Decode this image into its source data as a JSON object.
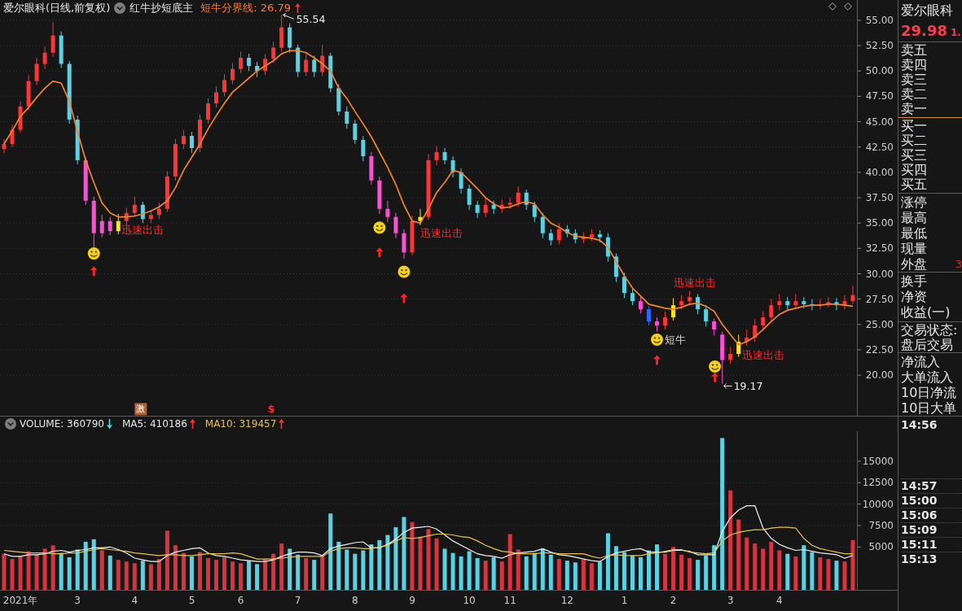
{
  "price_pane": {
    "header": {
      "title": "爱尔眼科(日线,前复权)",
      "indicator": "红牛抄短底主",
      "value": {
        "label": "短牛分界线: 26.79",
        "rising": true
      }
    },
    "chart_data": [
      {
        "type": "candlestick",
        "ylim": [
          16,
          57
        ],
        "tick_labels": "y",
        "grid": true,
        "yticks": [
          {
            "value": 20,
            "label": "20.00"
          },
          {
            "value": 22.5,
            "label": "22.50"
          },
          {
            "value": 25,
            "label": "25.00"
          },
          {
            "value": 27.5,
            "label": "27.50"
          },
          {
            "value": 30,
            "label": "30.00"
          },
          {
            "value": 32.5,
            "label": "32.50"
          },
          {
            "value": 35,
            "label": "35.00"
          },
          {
            "value": 37.5,
            "label": "37.50"
          },
          {
            "value": 40,
            "label": "40.00"
          },
          {
            "value": 42.5,
            "label": "42.50"
          },
          {
            "value": 45,
            "label": "45.00"
          },
          {
            "value": 47.5,
            "label": "47.50"
          },
          {
            "value": 50,
            "label": "50.00"
          },
          {
            "value": 52.5,
            "label": "52.50"
          },
          {
            "value": 55,
            "label": "55.00"
          }
        ],
        "series": [
          {
            "type": "candlestick",
            "ohlc": [
              [
                42.3,
                43.3,
                41.9,
                42.8
              ],
              [
                42.8,
                44.7,
                42.5,
                44.2
              ],
              [
                44.2,
                47.0,
                43.9,
                46.5
              ],
              [
                46.5,
                49.6,
                46.1,
                49.0
              ],
              [
                49.0,
                51.3,
                48.6,
                50.7
              ],
              [
                50.7,
                52.4,
                50.2,
                51.8
              ],
              [
                51.8,
                54.8,
                51.4,
                53.5
              ],
              [
                53.5,
                53.9,
                50.3,
                50.7
              ],
              [
                50.7,
                51.0,
                44.8,
                45.2
              ],
              [
                45.2,
                45.6,
                40.8,
                41.2
              ],
              [
                41.2,
                41.5,
                36.8,
                37.2
              ],
              [
                37.2,
                37.6,
                32.6,
                34.0
              ],
              [
                34.0,
                35.8,
                33.6,
                35.2
              ],
              [
                35.2,
                35.6,
                33.8,
                34.2
              ],
              [
                34.2,
                35.9,
                33.9,
                35.2
              ],
              [
                35.2,
                36.5,
                34.8,
                36.0
              ],
              [
                36.0,
                37.6,
                35.6,
                36.8
              ],
              [
                36.8,
                37.1,
                35.0,
                35.4
              ],
              [
                35.4,
                36.3,
                35.0,
                35.8
              ],
              [
                35.8,
                37.0,
                35.4,
                36.4
              ],
              [
                36.4,
                40.1,
                36.1,
                39.6
              ],
              [
                39.6,
                43.3,
                39.2,
                42.8
              ],
              [
                42.8,
                44.2,
                42.3,
                43.6
              ],
              [
                43.6,
                44.0,
                41.9,
                42.4
              ],
              [
                42.4,
                45.7,
                42.0,
                45.2
              ],
              [
                45.2,
                47.3,
                44.8,
                46.8
              ],
              [
                46.8,
                48.5,
                46.4,
                47.9
              ],
              [
                47.9,
                49.7,
                47.5,
                49.1
              ],
              [
                49.1,
                50.8,
                48.7,
                50.2
              ],
              [
                50.2,
                51.9,
                49.8,
                51.3
              ],
              [
                51.3,
                51.7,
                50.0,
                50.5
              ],
              [
                50.5,
                50.9,
                49.4,
                50.0
              ],
              [
                50.0,
                51.7,
                49.6,
                51.2
              ],
              [
                51.2,
                52.9,
                50.8,
                52.3
              ],
              [
                52.3,
                55.54,
                51.9,
                54.3
              ],
              [
                54.3,
                54.7,
                51.8,
                52.3
              ],
              [
                52.3,
                52.6,
                49.4,
                49.9
              ],
              [
                49.9,
                51.7,
                49.5,
                51.1
              ],
              [
                51.1,
                51.5,
                49.4,
                49.9
              ],
              [
                49.9,
                52.6,
                49.5,
                51.5
              ],
              [
                51.5,
                51.8,
                47.9,
                48.3
              ],
              [
                48.3,
                48.7,
                45.6,
                46.0
              ],
              [
                46.0,
                46.5,
                44.3,
                44.8
              ],
              [
                44.8,
                45.2,
                42.8,
                43.2
              ],
              [
                43.2,
                43.6,
                41.1,
                41.6
              ],
              [
                41.6,
                42.0,
                38.8,
                39.2
              ],
              [
                39.2,
                39.6,
                35.9,
                36.4
              ],
              [
                36.4,
                37.2,
                35.1,
                35.6
              ],
              [
                35.6,
                36.0,
                33.5,
                34.0
              ],
              [
                34.0,
                34.4,
                31.5,
                32.1
              ],
              [
                32.1,
                35.7,
                31.8,
                35.2
              ],
              [
                35.2,
                36.4,
                34.8,
                35.6
              ],
              [
                35.6,
                41.8,
                35.3,
                41.2
              ],
              [
                41.2,
                42.6,
                40.7,
                42.0
              ],
              [
                42.0,
                42.4,
                40.8,
                41.2
              ],
              [
                41.2,
                41.6,
                39.5,
                40.0
              ],
              [
                40.0,
                40.4,
                37.9,
                38.4
              ],
              [
                38.4,
                38.8,
                36.3,
                36.8
              ],
              [
                36.8,
                37.2,
                35.5,
                36.0
              ],
              [
                36.0,
                37.4,
                35.6,
                36.8
              ],
              [
                36.8,
                37.2,
                35.9,
                36.4
              ],
              [
                36.4,
                37.3,
                36.0,
                36.8
              ],
              [
                36.8,
                37.5,
                36.4,
                37.0
              ],
              [
                37.0,
                38.6,
                36.6,
                38.0
              ],
              [
                38.0,
                38.3,
                36.3,
                36.8
              ],
              [
                36.8,
                37.1,
                35.1,
                35.6
              ],
              [
                35.6,
                36.0,
                33.5,
                34.0
              ],
              [
                34.0,
                34.4,
                32.8,
                33.3
              ],
              [
                33.3,
                35.0,
                32.9,
                34.4
              ],
              [
                34.4,
                34.8,
                33.6,
                34.0
              ],
              [
                34.0,
                34.4,
                33.0,
                33.4
              ],
              [
                33.4,
                34.1,
                33.0,
                33.6
              ],
              [
                33.6,
                34.4,
                33.2,
                33.9
              ],
              [
                33.9,
                34.3,
                33.1,
                33.6
              ],
              [
                33.6,
                34.0,
                31.2,
                31.7
              ],
              [
                31.7,
                32.0,
                29.2,
                29.7
              ],
              [
                29.7,
                30.1,
                27.6,
                28.1
              ],
              [
                28.1,
                28.5,
                26.9,
                27.3
              ],
              [
                27.3,
                27.7,
                26.1,
                26.5
              ],
              [
                26.5,
                26.8,
                24.9,
                25.3
              ],
              [
                25.3,
                25.7,
                24.3,
                24.9
              ],
              [
                24.9,
                26.3,
                24.5,
                25.7
              ],
              [
                25.7,
                27.6,
                25.4,
                26.9
              ],
              [
                26.9,
                27.9,
                26.5,
                27.3
              ],
              [
                27.3,
                28.3,
                26.9,
                27.7
              ],
              [
                27.7,
                28.0,
                26.0,
                26.5
              ],
              [
                26.5,
                26.9,
                24.8,
                25.3
              ],
              [
                25.3,
                25.6,
                23.9,
                24.5
              ],
              [
                24.0,
                24.3,
                19.17,
                21.5
              ],
              [
                21.5,
                22.8,
                21.1,
                22.1
              ],
              [
                22.1,
                24.0,
                21.8,
                23.3
              ],
              [
                23.3,
                24.5,
                22.9,
                23.7
              ],
              [
                23.7,
                25.5,
                23.3,
                24.9
              ],
              [
                24.9,
                26.3,
                24.5,
                25.7
              ],
              [
                25.7,
                27.5,
                25.3,
                26.9
              ],
              [
                26.9,
                28.0,
                26.4,
                27.3
              ],
              [
                27.3,
                27.7,
                26.4,
                26.9
              ],
              [
                26.9,
                28.0,
                26.5,
                27.3
              ],
              [
                27.3,
                27.7,
                26.6,
                27.0
              ],
              [
                27.0,
                27.5,
                26.4,
                26.9
              ],
              [
                26.9,
                27.5,
                26.5,
                27.0
              ],
              [
                27.0,
                27.7,
                26.7,
                27.2
              ],
              [
                27.2,
                27.6,
                26.4,
                26.9
              ],
              [
                26.9,
                27.9,
                26.5,
                27.3
              ],
              [
                27.3,
                28.8,
                27.0,
                27.9
              ]
            ],
            "colors": [
              "#ff3434",
              "#ff3434",
              "#ff3434",
              "#ff3434",
              "#ff3434",
              "#ff3434",
              "#ff3434",
              "#5ad2e6",
              "#5ad2e6",
              "#5ad2e6",
              "#ff4fd8",
              "#ff4fd8",
              "#ff4fd8",
              "#ff4fd8",
              "#ffe41a",
              "#ff3434",
              "#ff3434",
              "#5ad2e6",
              "#ff3434",
              "#ff3434",
              "#ff3434",
              "#ff3434",
              "#ff3434",
              "#5ad2e6",
              "#ff3434",
              "#ff3434",
              "#ff3434",
              "#ff3434",
              "#ff3434",
              "#ff3434",
              "#5ad2e6",
              "#5ad2e6",
              "#ff3434",
              "#ff3434",
              "#ff3434",
              "#5ad2e6",
              "#5ad2e6",
              "#ff3434",
              "#5ad2e6",
              "#ff3434",
              "#5ad2e6",
              "#5ad2e6",
              "#5ad2e6",
              "#5ad2e6",
              "#5ad2e6",
              "#ff4fd8",
              "#ff4fd8",
              "#ff4fd8",
              "#ff4fd8",
              "#ff4fd8",
              "#ff3434",
              "#ffe41a",
              "#ff3434",
              "#ff3434",
              "#5ad2e6",
              "#5ad2e6",
              "#5ad2e6",
              "#5ad2e6",
              "#5ad2e6",
              "#ff3434",
              "#5ad2e6",
              "#ff3434",
              "#ff3434",
              "#ff3434",
              "#5ad2e6",
              "#5ad2e6",
              "#5ad2e6",
              "#5ad2e6",
              "#ff3434",
              "#5ad2e6",
              "#5ad2e6",
              "#ff3434",
              "#ff3434",
              "#5ad2e6",
              "#5ad2e6",
              "#5ad2e6",
              "#5ad2e6",
              "#5ad2e6",
              "#ff4fd8",
              "#2a66ff",
              "#ff4fd8",
              "#ff3434",
              "#ffe41a",
              "#ff3434",
              "#ff3434",
              "#5ad2e6",
              "#5ad2e6",
              "#ff4fd8",
              "#ff4fd8",
              "#ff3434",
              "#ffe41a",
              "#ff3434",
              "#ff3434",
              "#ff3434",
              "#ff3434",
              "#ff3434",
              "#5ad2e6",
              "#ff3434",
              "#5ad2e6",
              "#5ad2e6",
              "#ff3434",
              "#ff3434",
              "#5ad2e6",
              "#ff3434",
              "#ff3434"
            ]
          },
          {
            "type": "line",
            "color": "#f5832e",
            "values": [
              42.8,
              44.1,
              45.5,
              46.4,
              47.4,
              48.3,
              49.0,
              48.8,
              47.0,
              44.0,
              41.2,
              39.0,
              37.0,
              36.0,
              35.6,
              35.6,
              35.7,
              35.9,
              36.2,
              36.6,
              37.2,
              38.5,
              40.2,
              41.5,
              42.8,
              44.3,
              45.6,
              46.8,
              47.9,
              48.6,
              49.3,
              50.0,
              50.5,
              51.0,
              51.7,
              52.0,
              52.0,
              51.8,
              51.3,
              50.7,
              50.0,
              48.3,
              47.3,
              46.0,
              44.8,
              43.5,
              42.0,
              40.5,
              38.8,
              36.8,
              35.2,
              35.0,
              36.4,
              38.0,
              39.0,
              40.2,
              40.0,
              39.2,
              38.4,
              37.5,
              36.9,
              36.5,
              36.6,
              36.9,
              37.1,
              36.9,
              35.8,
              35.0,
              34.6,
              34.1,
              33.7,
              33.6,
              33.5,
              33.3,
              32.6,
              31.2,
              29.8,
              28.6,
              27.8,
              27.0,
              26.8,
              26.6,
              26.5,
              26.7,
              27.0,
              27.1,
              26.8,
              26.3,
              25.0,
              24.0,
              23.0,
              23.3,
              23.8,
              24.5,
              25.3,
              26.0,
              26.4,
              26.6,
              26.8,
              26.9,
              26.9,
              27.0,
              27.0,
              26.9,
              26.8
            ]
          }
        ],
        "annotations": [
          "55.54",
          "迅速出击",
          "迅速出击",
          "迅速出击",
          "短牛",
          "迅速出击",
          "19.17",
          "激",
          "$"
        ]
      }
    ]
  },
  "volume_pane": {
    "header": [
      {
        "label": "VOLUME: 360790",
        "rising": false,
        "color": "#e6e6e6"
      },
      {
        "label": "MA5: 410186",
        "rising": true,
        "color": "#e6e6e6"
      },
      {
        "label": "MA10: 319457",
        "rising": true,
        "color": "#e3c25a"
      }
    ],
    "chart_data": [
      {
        "type": "bar",
        "ylim": [
          0,
          18500
        ],
        "yticks": [
          5000,
          7500,
          10000,
          12500,
          15000
        ],
        "grid": true,
        "categories": [
          null,
          null,
          "2021年",
          null,
          null,
          null,
          null,
          null,
          null,
          "3",
          null,
          null,
          null,
          null,
          null,
          null,
          "4",
          null,
          null,
          null,
          null,
          null,
          null,
          "5",
          null,
          null,
          null,
          null,
          null,
          "6",
          null,
          null,
          null,
          null,
          null,
          null,
          "7",
          null,
          null,
          null,
          null,
          null,
          null,
          "8",
          null,
          null,
          null,
          null,
          null,
          null,
          "9",
          null,
          null,
          null,
          null,
          null,
          null,
          "10",
          null,
          null,
          null,
          null,
          "11",
          null,
          null,
          null,
          null,
          null,
          null,
          "12",
          null,
          null,
          null,
          null,
          null,
          null,
          "1",
          null,
          null,
          null,
          null,
          null,
          "2",
          null,
          null,
          null,
          null,
          null,
          null,
          "3",
          null,
          null,
          null,
          null,
          null,
          "4",
          null,
          null,
          null,
          null,
          null,
          null,
          null,
          null,
          null
        ],
        "series": [
          {
            "type": "bar",
            "values": [
              4200,
              3600,
              3900,
              4500,
              4100,
              4800,
              5200,
              4300,
              3800,
              4700,
              5600,
              5900,
              4600,
              4000,
              3500,
              3300,
              3100,
              3400,
              3000,
              3600,
              6900,
              5200,
              4300,
              3900,
              4400,
              3700,
              3500,
              3800,
              3300,
              3100,
              3400,
              3000,
              3600,
              4200,
              5400,
              4800,
              4100,
              3700,
              3500,
              4000,
              8900,
              5600,
              4700,
              4200,
              4600,
              5300,
              5800,
              6400,
              7300,
              8500,
              7900,
              6200,
              7100,
              6000,
              4800,
              4300,
              3900,
              4500,
              3700,
              3400,
              3800,
              3300,
              6500,
              4700,
              3900,
              4300,
              4800,
              4100,
              3600,
              3400,
              3200,
              3500,
              3100,
              3300,
              6600,
              5100,
              4400,
              4000,
              3800,
              4600,
              5300,
              4200,
              5000,
              4100,
              3700,
              3500,
              4000,
              5200,
              17700,
              11600,
              8200,
              6100,
              5400,
              4800,
              5600,
              4600,
              4200,
              3900,
              5200,
              4400,
              3800,
              3600,
              3400,
              3300,
              5800
            ],
            "colors": [
              "#d8343f",
              "#d8343f",
              "#d8343f",
              "#d8343f",
              "#d8343f",
              "#d8343f",
              "#d8343f",
              "#5ad2e6",
              "#5ad2e6",
              "#5ad2e6",
              "#5ad2e6",
              "#5ad2e6",
              "#d8343f",
              "#5ad2e6",
              "#d8343f",
              "#d8343f",
              "#d8343f",
              "#5ad2e6",
              "#d8343f",
              "#d8343f",
              "#d8343f",
              "#d8343f",
              "#d8343f",
              "#5ad2e6",
              "#d8343f",
              "#d8343f",
              "#d8343f",
              "#d8343f",
              "#d8343f",
              "#d8343f",
              "#5ad2e6",
              "#5ad2e6",
              "#d8343f",
              "#d8343f",
              "#d8343f",
              "#5ad2e6",
              "#5ad2e6",
              "#d8343f",
              "#5ad2e6",
              "#d8343f",
              "#5ad2e6",
              "#5ad2e6",
              "#5ad2e6",
              "#5ad2e6",
              "#5ad2e6",
              "#5ad2e6",
              "#5ad2e6",
              "#5ad2e6",
              "#5ad2e6",
              "#5ad2e6",
              "#d8343f",
              "#d8343f",
              "#d8343f",
              "#d8343f",
              "#5ad2e6",
              "#5ad2e6",
              "#5ad2e6",
              "#5ad2e6",
              "#5ad2e6",
              "#d8343f",
              "#5ad2e6",
              "#d8343f",
              "#d8343f",
              "#d8343f",
              "#5ad2e6",
              "#5ad2e6",
              "#5ad2e6",
              "#5ad2e6",
              "#d8343f",
              "#5ad2e6",
              "#5ad2e6",
              "#d8343f",
              "#d8343f",
              "#5ad2e6",
              "#5ad2e6",
              "#5ad2e6",
              "#5ad2e6",
              "#5ad2e6",
              "#5ad2e6",
              "#5ad2e6",
              "#5ad2e6",
              "#d8343f",
              "#d8343f",
              "#d8343f",
              "#d8343f",
              "#5ad2e6",
              "#5ad2e6",
              "#5ad2e6",
              "#5ad2e6",
              "#d8343f",
              "#d8343f",
              "#d8343f",
              "#d8343f",
              "#d8343f",
              "#d8343f",
              "#d8343f",
              "#5ad2e6",
              "#d8343f",
              "#5ad2e6",
              "#5ad2e6",
              "#d8343f",
              "#d8343f",
              "#5ad2e6",
              "#d8343f",
              "#d8343f"
            ]
          },
          {
            "type": "line",
            "color": "#f0f0f0",
            "values": [
              4200,
              3900,
              3900,
              4100,
              4100,
              4200,
              4500,
              4600,
              4400,
              4600,
              4700,
              4900,
              4900,
              5000,
              4700,
              4300,
              3700,
              3500,
              3300,
              3300,
              4000,
              4400,
              4600,
              4800,
              4900,
              4300,
              4000,
              3900,
              3700,
              3500,
              3400,
              3300,
              3300,
              3500,
              3900,
              4200,
              4400,
              4400,
              4300,
              4000,
              4800,
              5100,
              5300,
              5500,
              5600,
              4900,
              4900,
              5300,
              5900,
              6700,
              7200,
              7300,
              7400,
              7100,
              6400,
              5700,
              5200,
              4700,
              4200,
              4000,
              3900,
              3700,
              4100,
              4300,
              4400,
              4500,
              4800,
              4400,
              4100,
              4000,
              3800,
              3600,
              3400,
              3300,
              3900,
              4300,
              4500,
              4700,
              4800,
              4400,
              4400,
              4400,
              4600,
              4600,
              4500,
              4100,
              4100,
              4100,
              6800,
              8400,
              9300,
              9800,
              9800,
              7200,
              6000,
              5300,
              4900,
              4600,
              4700,
              4500,
              4300,
              4200,
              4100,
              3700,
              4000
            ]
          },
          {
            "type": "line",
            "color": "#e3c25a",
            "values": [
              4600,
              4500,
              4400,
              4300,
              4300,
              4300,
              4200,
              4200,
              4300,
              4300,
              4500,
              4700,
              4800,
              4700,
              4600,
              4500,
              4300,
              4200,
              4100,
              4000,
              4100,
              4100,
              4000,
              4000,
              4100,
              4200,
              4200,
              4200,
              4300,
              4200,
              3900,
              3600,
              3600,
              3600,
              3700,
              3800,
              3900,
              3900,
              3900,
              3900,
              4500,
              4800,
              4900,
              4900,
              4800,
              4800,
              5000,
              5200,
              5700,
              6100,
              6000,
              6100,
              6300,
              6500,
              6500,
              6400,
              6200,
              6100,
              5700,
              5200,
              4800,
              4500,
              4400,
              4200,
              4200,
              4200,
              4300,
              4300,
              4200,
              4200,
              4200,
              4200,
              3900,
              3700,
              4000,
              4100,
              4000,
              4000,
              4000,
              4200,
              4300,
              4500,
              4700,
              4700,
              4400,
              4300,
              4200,
              4300,
              5700,
              6400,
              6700,
              6900,
              7000,
              7000,
              7200,
              7300,
              7300,
              7200,
              6000,
              5200,
              4800,
              4600,
              4400,
              4200,
              4200
            ]
          }
        ]
      }
    ]
  },
  "quote_panel": {
    "name": "爱尔眼科",
    "price": "29.98",
    "change": "1.",
    "sections": [
      {
        "kind": "ask",
        "rows": [
          {
            "label": "卖五"
          },
          {
            "label": "卖四"
          },
          {
            "label": "卖三"
          },
          {
            "label": "卖二"
          },
          {
            "label": "卖一"
          }
        ]
      },
      {
        "kind": "bid",
        "rows": [
          {
            "label": "买一"
          },
          {
            "label": "买二"
          },
          {
            "label": "买三"
          },
          {
            "label": "买四"
          },
          {
            "label": "买五"
          }
        ]
      },
      {
        "kind": "stats",
        "rows": [
          {
            "label": "涨停"
          },
          {
            "label": "最高"
          },
          {
            "label": "最低"
          },
          {
            "label": "现量"
          },
          {
            "label": "外盘",
            "value": "3"
          }
        ]
      },
      {
        "kind": "finance",
        "rows": [
          {
            "label": "换手"
          },
          {
            "label": "净资"
          },
          {
            "label": "收益(一)"
          }
        ]
      },
      {
        "kind": "status",
        "rows": [
          {
            "label": "交易状态:"
          },
          {
            "label": "盘后交易"
          }
        ]
      },
      {
        "kind": "flow",
        "rows": [
          {
            "label": "净流入"
          },
          {
            "label": "大单流入"
          },
          {
            "label": "10日净流"
          },
          {
            "label": "10日大单"
          }
        ]
      }
    ],
    "ticks": [
      {
        "time": "14:56"
      },
      {
        "time": "14:57"
      },
      {
        "time": "15:00"
      },
      {
        "time": "15:06"
      },
      {
        "time": "15:09"
      },
      {
        "time": "15:11"
      },
      {
        "time": "15:13"
      }
    ]
  }
}
